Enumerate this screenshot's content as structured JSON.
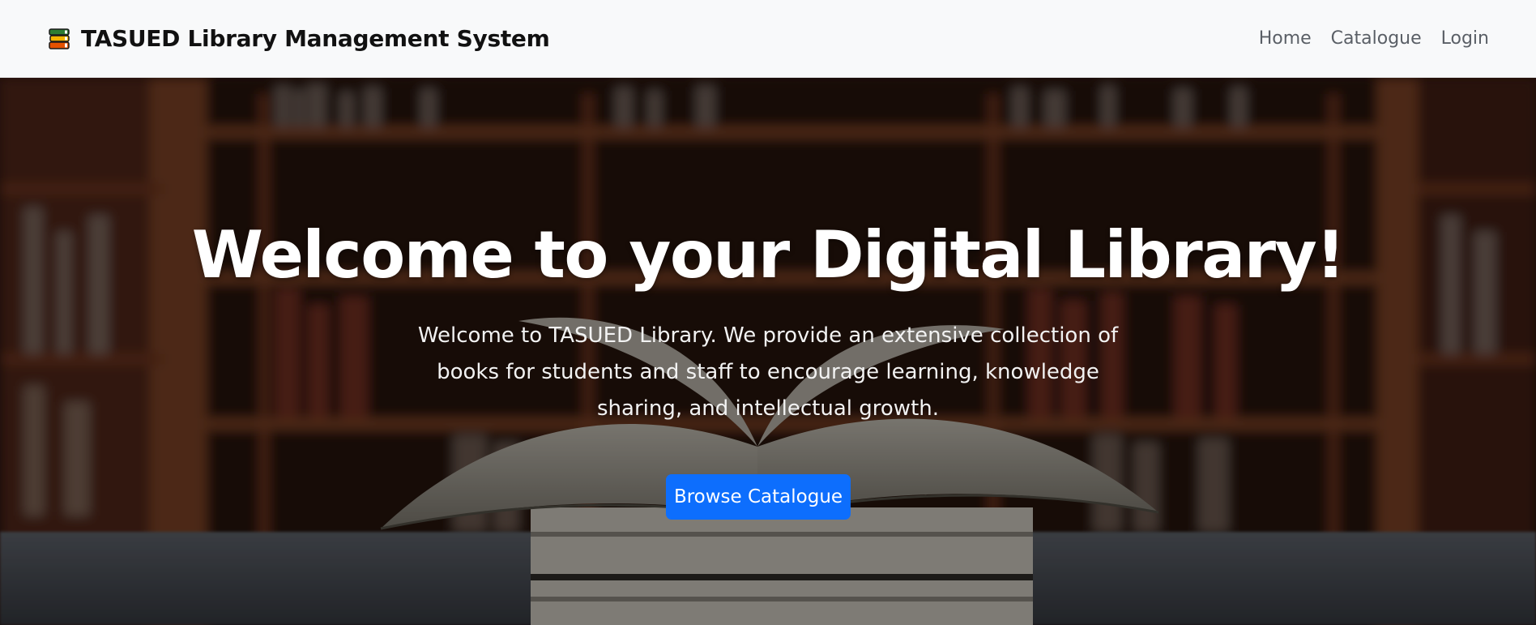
{
  "navbar": {
    "brand_icon": "books-stack-icon",
    "brand_title": "TASUED Library Management System",
    "links": [
      {
        "label": "Home"
      },
      {
        "label": "Catalogue"
      },
      {
        "label": "Login"
      }
    ]
  },
  "hero": {
    "background": "library-bookshelves-open-book-photo",
    "title": "Welcome to your Digital Library!",
    "description": "Welcome to TASUED Library. We provide an extensive collection of books for students and staff to encourage learning, knowledge sharing, and intellectual growth.",
    "cta_label": "Browse Catalogue",
    "cta_color": "#0d6efd"
  }
}
